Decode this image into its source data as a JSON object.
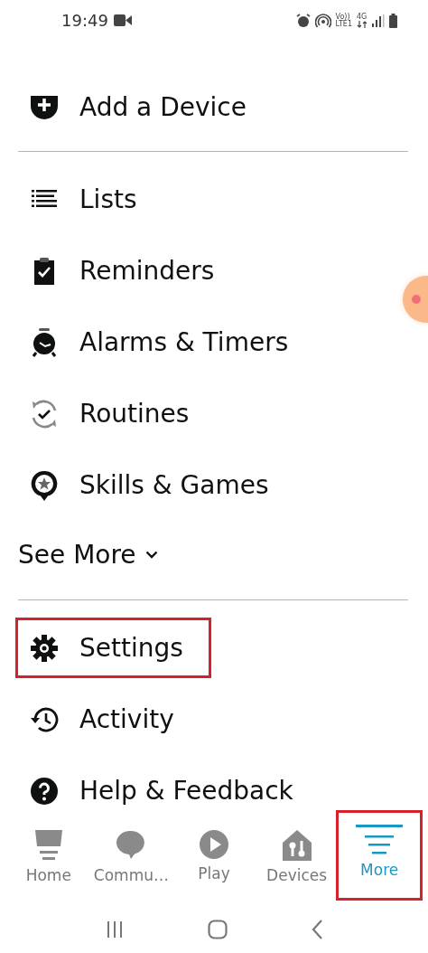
{
  "status_bar": {
    "time": "19:49",
    "volte": "Vo))",
    "lte": "LTE1",
    "network": "4G"
  },
  "top_item": {
    "label": "Add a Device"
  },
  "menu": [
    {
      "label": "Lists"
    },
    {
      "label": "Reminders"
    },
    {
      "label": "Alarms & Timers"
    },
    {
      "label": "Routines"
    },
    {
      "label": "Skills & Games"
    }
  ],
  "see_more": {
    "label": "See More",
    "expanded": false
  },
  "settings_menu": [
    {
      "label": "Settings",
      "highlighted": true
    },
    {
      "label": "Activity",
      "highlighted": false
    },
    {
      "label": "Help & Feedback",
      "highlighted": false
    }
  ],
  "tab_bar": [
    {
      "label": "Home",
      "selected": false,
      "highlighted": false
    },
    {
      "label": "Commu…",
      "selected": false,
      "highlighted": false
    },
    {
      "label": "Play",
      "selected": false,
      "highlighted": false
    },
    {
      "label": "Devices",
      "selected": false,
      "highlighted": false
    },
    {
      "label": "More",
      "selected": true,
      "highlighted": true
    }
  ]
}
